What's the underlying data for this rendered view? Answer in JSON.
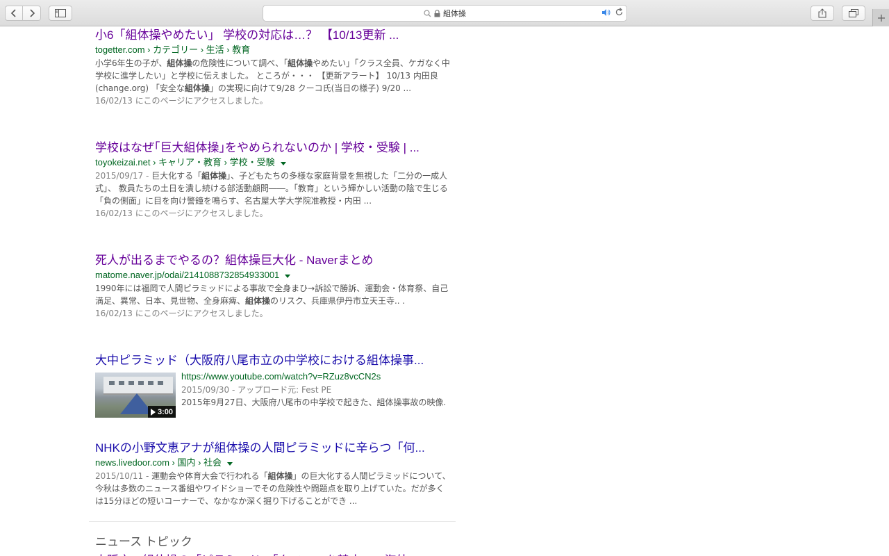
{
  "browser": {
    "address_text": "組体操",
    "icons": {
      "back": "chevron-left-icon",
      "forward": "chevron-right-icon",
      "sidebar": "sidebar-icon",
      "search": "search-icon",
      "lock": "lock-icon",
      "sound": "speaker-icon",
      "reload": "reload-icon",
      "share": "share-icon",
      "tabs": "tab-overview-icon",
      "new_tab": "plus-icon"
    }
  },
  "results": [
    {
      "title": "小6「組体操やめたい」 学校の対応は…？ 【10/13更新 ...",
      "url": "togetter.com › カテゴリー › 生活 › 教育",
      "snippet_parts": [
        "小学6年生の子が、",
        "組体操",
        "の危険性について調べ、「",
        "組体操",
        "やめたい」「クラス全員、ケガなく中学校に進学したい」と学校に伝えました。 ところが・・・ 【更新アラート】 10/13 内田良(change.org) 「安全な",
        "組体操",
        "」の実現に向けて9/28 クーコ氏(当日の様子) 9/20  ..."
      ],
      "visited_note": "16/02/13 にこのページにアクセスしました。"
    },
    {
      "title": "学校はなぜ｢巨大組体操｣をやめられないのか | 学校・受験 | ...",
      "url": "toyokeizai.net › キャリア・教育 › 学校・受験",
      "date": "2015/09/17 - ",
      "snippet_parts": [
        "巨大化する「",
        "組体操",
        "」、子どもたちの多様な家庭背景を無視した「二分の一成人式」、 教員たちの土日を潰し続ける部活動顧問――。「教育」という輝かしい活動の陰で生じる「負の側面」に目を向け警鐘を鳴らす、名古屋大学大学院准教授・内田 ..."
      ],
      "visited_note": "16/02/13 にこのページにアクセスしました。"
    },
    {
      "title": "死人が出るまでやるの？組体操巨大化 - Naverまとめ",
      "url": "matome.naver.jp/odai/2141088732854933001",
      "snippet_parts": [
        "1990年には福岡で人間ピラミッドによる事故で全身まひ→訴訟で勝訴、運動会・体育祭、自己満足、異常、日本、見世物、全身麻痺、",
        "組体操",
        "のリスク、兵庫県伊丹市立天王寺.. ."
      ],
      "visited_note": "16/02/13 にこのページにアクセスしました。"
    },
    {
      "title": "大中ピラミッド（大阪府八尾市立の中学校における組体操事...",
      "url": "https://www.youtube.com/watch?v=RZuz8vcCN2s",
      "date": "2015/09/30 - アップロード元: Fest PE",
      "description": "2015年9月27日、大阪府八尾市の中学校で起きた、組体操事故の映像.",
      "duration": "3:00"
    },
    {
      "title": "NHKの小野文恵アナが組体操の人間ピラミッドに辛らつ「何...",
      "url": "news.livedoor.com › 国内 › 社会",
      "date": "2015/10/11 - ",
      "snippet_parts": [
        "運動会や体育大会で行われる「",
        "組体操",
        "」の巨大化する人間ピラミッドについて、今秋は多数のニュース番組やワイドショーでその危険性や問題点を取り上げていた。だが多くは15分ほどの短いコーナーで、なかなか深く掘り下げることができ ..."
      ]
    }
  ],
  "news": {
    "heading": "ニュース トピック",
    "first_item": "大阪市　組体操の「ピラミッド」「タワー」を禁止へ　海外"
  }
}
